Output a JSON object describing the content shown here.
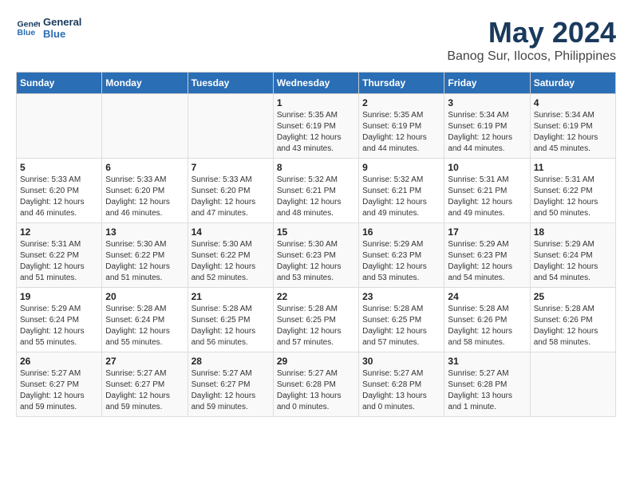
{
  "header": {
    "logo_line1": "General",
    "logo_line2": "Blue",
    "title": "May 2024",
    "subtitle": "Banog Sur, Ilocos, Philippines"
  },
  "weekdays": [
    "Sunday",
    "Monday",
    "Tuesday",
    "Wednesday",
    "Thursday",
    "Friday",
    "Saturday"
  ],
  "weeks": [
    [
      {
        "day": "",
        "info": ""
      },
      {
        "day": "",
        "info": ""
      },
      {
        "day": "",
        "info": ""
      },
      {
        "day": "1",
        "info": "Sunrise: 5:35 AM\nSunset: 6:19 PM\nDaylight: 12 hours\nand 43 minutes."
      },
      {
        "day": "2",
        "info": "Sunrise: 5:35 AM\nSunset: 6:19 PM\nDaylight: 12 hours\nand 44 minutes."
      },
      {
        "day": "3",
        "info": "Sunrise: 5:34 AM\nSunset: 6:19 PM\nDaylight: 12 hours\nand 44 minutes."
      },
      {
        "day": "4",
        "info": "Sunrise: 5:34 AM\nSunset: 6:19 PM\nDaylight: 12 hours\nand 45 minutes."
      }
    ],
    [
      {
        "day": "5",
        "info": "Sunrise: 5:33 AM\nSunset: 6:20 PM\nDaylight: 12 hours\nand 46 minutes."
      },
      {
        "day": "6",
        "info": "Sunrise: 5:33 AM\nSunset: 6:20 PM\nDaylight: 12 hours\nand 46 minutes."
      },
      {
        "day": "7",
        "info": "Sunrise: 5:33 AM\nSunset: 6:20 PM\nDaylight: 12 hours\nand 47 minutes."
      },
      {
        "day": "8",
        "info": "Sunrise: 5:32 AM\nSunset: 6:21 PM\nDaylight: 12 hours\nand 48 minutes."
      },
      {
        "day": "9",
        "info": "Sunrise: 5:32 AM\nSunset: 6:21 PM\nDaylight: 12 hours\nand 49 minutes."
      },
      {
        "day": "10",
        "info": "Sunrise: 5:31 AM\nSunset: 6:21 PM\nDaylight: 12 hours\nand 49 minutes."
      },
      {
        "day": "11",
        "info": "Sunrise: 5:31 AM\nSunset: 6:22 PM\nDaylight: 12 hours\nand 50 minutes."
      }
    ],
    [
      {
        "day": "12",
        "info": "Sunrise: 5:31 AM\nSunset: 6:22 PM\nDaylight: 12 hours\nand 51 minutes."
      },
      {
        "day": "13",
        "info": "Sunrise: 5:30 AM\nSunset: 6:22 PM\nDaylight: 12 hours\nand 51 minutes."
      },
      {
        "day": "14",
        "info": "Sunrise: 5:30 AM\nSunset: 6:22 PM\nDaylight: 12 hours\nand 52 minutes."
      },
      {
        "day": "15",
        "info": "Sunrise: 5:30 AM\nSunset: 6:23 PM\nDaylight: 12 hours\nand 53 minutes."
      },
      {
        "day": "16",
        "info": "Sunrise: 5:29 AM\nSunset: 6:23 PM\nDaylight: 12 hours\nand 53 minutes."
      },
      {
        "day": "17",
        "info": "Sunrise: 5:29 AM\nSunset: 6:23 PM\nDaylight: 12 hours\nand 54 minutes."
      },
      {
        "day": "18",
        "info": "Sunrise: 5:29 AM\nSunset: 6:24 PM\nDaylight: 12 hours\nand 54 minutes."
      }
    ],
    [
      {
        "day": "19",
        "info": "Sunrise: 5:29 AM\nSunset: 6:24 PM\nDaylight: 12 hours\nand 55 minutes."
      },
      {
        "day": "20",
        "info": "Sunrise: 5:28 AM\nSunset: 6:24 PM\nDaylight: 12 hours\nand 55 minutes."
      },
      {
        "day": "21",
        "info": "Sunrise: 5:28 AM\nSunset: 6:25 PM\nDaylight: 12 hours\nand 56 minutes."
      },
      {
        "day": "22",
        "info": "Sunrise: 5:28 AM\nSunset: 6:25 PM\nDaylight: 12 hours\nand 57 minutes."
      },
      {
        "day": "23",
        "info": "Sunrise: 5:28 AM\nSunset: 6:25 PM\nDaylight: 12 hours\nand 57 minutes."
      },
      {
        "day": "24",
        "info": "Sunrise: 5:28 AM\nSunset: 6:26 PM\nDaylight: 12 hours\nand 58 minutes."
      },
      {
        "day": "25",
        "info": "Sunrise: 5:28 AM\nSunset: 6:26 PM\nDaylight: 12 hours\nand 58 minutes."
      }
    ],
    [
      {
        "day": "26",
        "info": "Sunrise: 5:27 AM\nSunset: 6:27 PM\nDaylight: 12 hours\nand 59 minutes."
      },
      {
        "day": "27",
        "info": "Sunrise: 5:27 AM\nSunset: 6:27 PM\nDaylight: 12 hours\nand 59 minutes."
      },
      {
        "day": "28",
        "info": "Sunrise: 5:27 AM\nSunset: 6:27 PM\nDaylight: 12 hours\nand 59 minutes."
      },
      {
        "day": "29",
        "info": "Sunrise: 5:27 AM\nSunset: 6:28 PM\nDaylight: 13 hours\nand 0 minutes."
      },
      {
        "day": "30",
        "info": "Sunrise: 5:27 AM\nSunset: 6:28 PM\nDaylight: 13 hours\nand 0 minutes."
      },
      {
        "day": "31",
        "info": "Sunrise: 5:27 AM\nSunset: 6:28 PM\nDaylight: 13 hours\nand 1 minute."
      },
      {
        "day": "",
        "info": ""
      }
    ]
  ]
}
